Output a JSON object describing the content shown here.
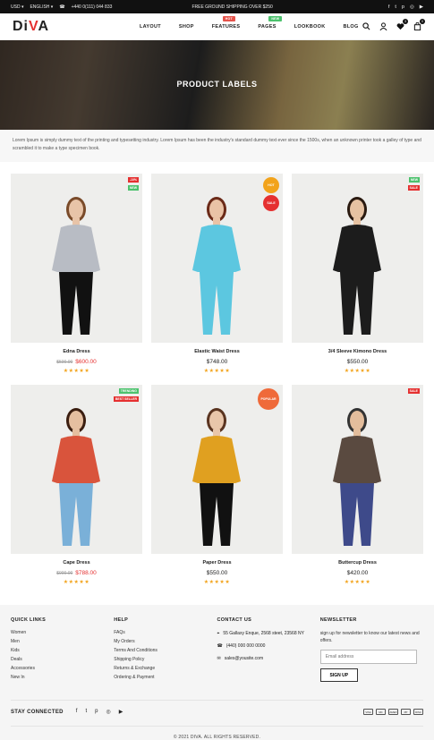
{
  "topbar": {
    "currency": "USD ▾",
    "language": "ENGLISH ▾",
    "phone": "+440 0(111) 044 833",
    "shipping": "FREE GROUND SHIPPING OVER $250",
    "social": [
      "f",
      "t",
      "p",
      "◎",
      "▶"
    ]
  },
  "header": {
    "logo_main": "Di",
    "logo_accent": "V",
    "logo_end": "A",
    "nav": [
      {
        "label": "LAYOUT"
      },
      {
        "label": "SHOP"
      },
      {
        "label": "FEATURES",
        "badge": "HOT",
        "badge_color": "#e5534b"
      },
      {
        "label": "PAGES",
        "badge": "NEW",
        "badge_color": "#4cc26d"
      },
      {
        "label": "LOOKBOOK"
      },
      {
        "label": "BLOG"
      }
    ],
    "wishlist_count": "3",
    "cart_count": "0"
  },
  "hero": {
    "title": "PRODUCT LABELS"
  },
  "intro": "Lorem Ipsum is simply dummy text of the printing and typesetting industry. Lorem Ipsum has been the industry's standard dummy text ever since the 1500s, when an unknown printer took a galley of type and scrambled it to make a type specimen book.",
  "products": [
    {
      "name": "Edna Dress",
      "old_price": "$500.00",
      "price": "$600.00",
      "stars": "★★★★★",
      "labels": [
        {
          "text": "-10%",
          "color": "#e53030"
        },
        {
          "text": "NEW",
          "color": "#4cc26d"
        }
      ],
      "circles": []
    },
    {
      "name": "Elastic Waist Dress",
      "old_price": "",
      "price": "$748.00",
      "stars": "★★★★★",
      "labels": [],
      "circles": [
        {
          "text": "HOT",
          "color": "#f2a31b"
        },
        {
          "text": "SALE",
          "color": "#e53030"
        }
      ]
    },
    {
      "name": "3/4 Sleeve Kimono Dress",
      "old_price": "",
      "price": "$550.00",
      "stars": "★★★★★",
      "labels": [
        {
          "text": "NEW",
          "color": "#4cc26d"
        },
        {
          "text": "SALE",
          "color": "#e53030"
        }
      ],
      "circles": []
    },
    {
      "name": "Cape Dress",
      "old_price": "$900.00",
      "price": "$788.00",
      "stars": "★★★★★",
      "labels": [
        {
          "text": "TRENDING",
          "color": "#4cc26d"
        },
        {
          "text": "BEST SELLER",
          "color": "#e53030"
        }
      ],
      "circles": []
    },
    {
      "name": "Paper Dress",
      "old_price": "",
      "price": "$550.00",
      "stars": "★★★★★",
      "labels": [],
      "circles": [
        {
          "text": "POPULAR",
          "color": "#ef6a3a"
        }
      ]
    },
    {
      "name": "Buttercup Dress",
      "old_price": "",
      "price": "$420.00",
      "stars": "★★★★★",
      "labels": [
        {
          "text": "SALE",
          "color": "#e53030"
        }
      ],
      "circles": []
    }
  ],
  "footer": {
    "quick_links": {
      "title": "QUICK LINKS",
      "items": [
        "Women",
        "Men",
        "Kids",
        "Deals",
        "Accessories",
        "New In"
      ]
    },
    "help": {
      "title": "HELP",
      "items": [
        "FAQs",
        "My Orders",
        "Terms And Conditions",
        "Shipping Policy",
        "Returns & Exchange",
        "Ordering & Payment"
      ]
    },
    "contact": {
      "title": "CONTACT US",
      "address": "55 Gallaxy Enque, 2568 steet, 23568 NY",
      "phone": "(440) 000 000 0000",
      "email": "sales@yousite.com"
    },
    "newsletter": {
      "title": "NEWSLETTER",
      "text": "sign up for newsletter to know our latest news and offers.",
      "placeholder": "Email address",
      "button": "SIGN UP"
    },
    "stay_connected": "STAY CONNECTED",
    "social": [
      "f",
      "t",
      "p",
      "◎",
      "▶"
    ],
    "payments": [
      "VISA",
      "MC",
      "AMEX",
      "PP",
      "DISC"
    ],
    "copyright": "© 2021 DIVA. ALL RIGHTS RESERVED."
  }
}
